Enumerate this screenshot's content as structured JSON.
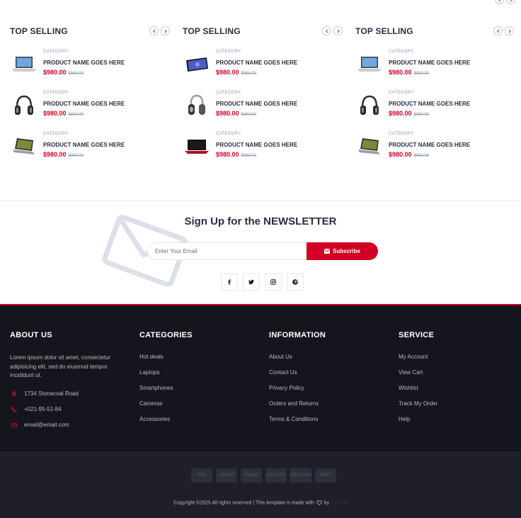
{
  "top_selling": {
    "columns": [
      {
        "title": "TOP SELLING",
        "products": [
          {
            "category": "CATEGORY",
            "name": "PRODUCT NAME GOES HERE",
            "price": "$980.00",
            "old_price": "$990.00",
            "image": "laptop-silver"
          },
          {
            "category": "CATEGORY",
            "name": "PRODUCT NAME GOES HERE",
            "price": "$980.00",
            "old_price": "$990.00",
            "image": "headphones"
          },
          {
            "category": "CATEGORY",
            "name": "PRODUCT NAME GOES HERE",
            "price": "$980.00",
            "old_price": "$990.00",
            "image": "laptop-dark"
          }
        ]
      },
      {
        "title": "TOP SELLING",
        "products": [
          {
            "category": "CATEGORY",
            "name": "PRODUCT NAME GOES HERE",
            "price": "$980.00",
            "old_price": "$990.00",
            "image": "tablet"
          },
          {
            "category": "CATEGORY",
            "name": "PRODUCT NAME GOES HERE",
            "price": "$980.00",
            "old_price": "$990.00",
            "image": "headphones"
          },
          {
            "category": "CATEGORY",
            "name": "PRODUCT NAME GOES HERE",
            "price": "$980.00",
            "old_price": "$990.00",
            "image": "laptop-black"
          }
        ]
      },
      {
        "title": "TOP SELLING",
        "products": [
          {
            "category": "CATEGORY",
            "name": "PRODUCT NAME GOES HERE",
            "price": "$980.00",
            "old_price": "$990.00",
            "image": "laptop-silver"
          },
          {
            "category": "CATEGORY",
            "name": "PRODUCT NAME GOES HERE",
            "price": "$980.00",
            "old_price": "$990.00",
            "image": "headphones"
          },
          {
            "category": "CATEGORY",
            "name": "PRODUCT NAME GOES HERE",
            "price": "$980.00",
            "old_price": "$990.00",
            "image": "laptop-dark"
          }
        ]
      }
    ]
  },
  "newsletter": {
    "title_prefix": "Sign Up for the ",
    "title_bold": "NEWSLETTER",
    "input_placeholder": "Enter Your Email",
    "button_label": "Subscribe",
    "social": [
      "facebook-icon",
      "twitter-icon",
      "instagram-icon",
      "pinterest-icon"
    ]
  },
  "footer": {
    "about": {
      "title": "ABOUT US",
      "text": "Lorem ipsum dolor sit amet, consectetur adipisicing elit, sed do eiusmod tempor incididunt ut.",
      "address": "1734 Stonecoal Road",
      "phone": "+021-95-51-84",
      "email": "email@email.com"
    },
    "categories": {
      "title": "CATEGORIES",
      "links": [
        "Hot deals",
        "Laptops",
        "Smartphones",
        "Cameras",
        "Accessories"
      ]
    },
    "information": {
      "title": "INFORMATION",
      "links": [
        "About Us",
        "Contact Us",
        "Privacy Policy",
        "Orders and Returns",
        "Terms & Conditions"
      ]
    },
    "service": {
      "title": "SERVICE",
      "links": [
        "My Account",
        "View Cart",
        "Wishlist",
        "Track My Order",
        "Help"
      ]
    },
    "payments": [
      "VISA",
      "CREDIT",
      "PayPal",
      "MASTER",
      "DISCOVER",
      "AMEX"
    ],
    "copyright_prefix": "Copyright ©2025 All rights reserved | This template is made with",
    "copyright_by": "by",
    "copyright_brand": "Colorlib"
  },
  "colors": {
    "accent": "#D10024",
    "footer_dark": "#15161D",
    "footer_bottom": "#1E1F29",
    "heading": "#2B2D42",
    "muted": "#8D99AE"
  }
}
